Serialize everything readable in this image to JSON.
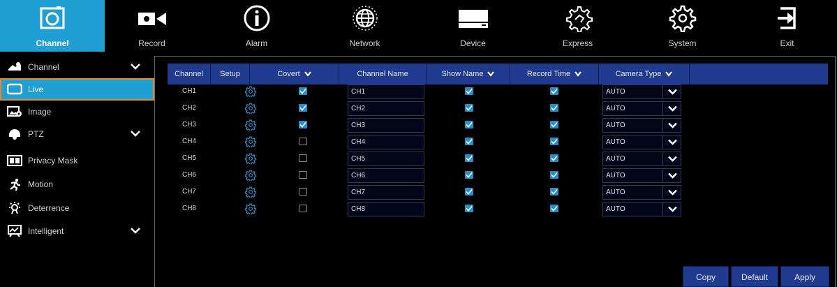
{
  "nav": [
    {
      "label": "Channel",
      "icon": "camera-icon",
      "active": true
    },
    {
      "label": "Record",
      "icon": "video-camera-icon"
    },
    {
      "label": "Alarm",
      "icon": "info-icon"
    },
    {
      "label": "Network",
      "icon": "globe-icon"
    },
    {
      "label": "Device",
      "icon": "hard-drive-icon"
    },
    {
      "label": "Express",
      "icon": "gear-hand-icon"
    },
    {
      "label": "System",
      "icon": "gear-icon"
    },
    {
      "label": "Exit",
      "icon": "exit-icon"
    }
  ],
  "sidebar": {
    "items": [
      {
        "label": "Channel",
        "icon": "channel-group-icon",
        "expandable": true
      },
      {
        "label": "Live",
        "icon": "monitor-icon",
        "selected": true
      },
      {
        "label": "Image",
        "icon": "image-settings-icon"
      },
      {
        "label": "PTZ",
        "icon": "ptz-dome-icon",
        "expandable": true
      },
      {
        "label": "Privacy Mask",
        "icon": "privacy-mask-icon"
      },
      {
        "label": "Motion",
        "icon": "running-person-icon"
      },
      {
        "label": "Deterrence",
        "icon": "light-bulb-icon"
      },
      {
        "label": "Intelligent",
        "icon": "intelligent-chart-icon",
        "expandable": true
      }
    ]
  },
  "table": {
    "headers": {
      "channel": "Channel",
      "setup": "Setup",
      "covert": "Covert",
      "channel_name": "Channel Name",
      "show_name": "Show Name",
      "record_time": "Record Time",
      "camera_type": "Camera Type"
    },
    "rows": [
      {
        "ch": "CH1",
        "covert": true,
        "name": "CH1",
        "show_name": true,
        "record_time": true,
        "camera_type": "AUTO"
      },
      {
        "ch": "CH2",
        "covert": true,
        "name": "CH2",
        "show_name": true,
        "record_time": true,
        "camera_type": "AUTO"
      },
      {
        "ch": "CH3",
        "covert": true,
        "name": "CH3",
        "show_name": true,
        "record_time": true,
        "camera_type": "AUTO"
      },
      {
        "ch": "CH4",
        "covert": false,
        "name": "CH4",
        "show_name": true,
        "record_time": true,
        "camera_type": "AUTO"
      },
      {
        "ch": "CH5",
        "covert": false,
        "name": "CH5",
        "show_name": true,
        "record_time": true,
        "camera_type": "AUTO"
      },
      {
        "ch": "CH6",
        "covert": false,
        "name": "CH6",
        "show_name": true,
        "record_time": true,
        "camera_type": "AUTO"
      },
      {
        "ch": "CH7",
        "covert": false,
        "name": "CH7",
        "show_name": true,
        "record_time": true,
        "camera_type": "AUTO"
      },
      {
        "ch": "CH8",
        "covert": false,
        "name": "CH8",
        "show_name": true,
        "record_time": true,
        "camera_type": "AUTO"
      }
    ]
  },
  "buttons": {
    "copy": "Copy",
    "default": "Default",
    "apply": "Apply"
  },
  "colors": {
    "accent": "#1f9fd4",
    "header_bg": "#1f3a8e",
    "checkbox_on": "#2a8fc8",
    "selected_outline": "#e88a2a"
  }
}
